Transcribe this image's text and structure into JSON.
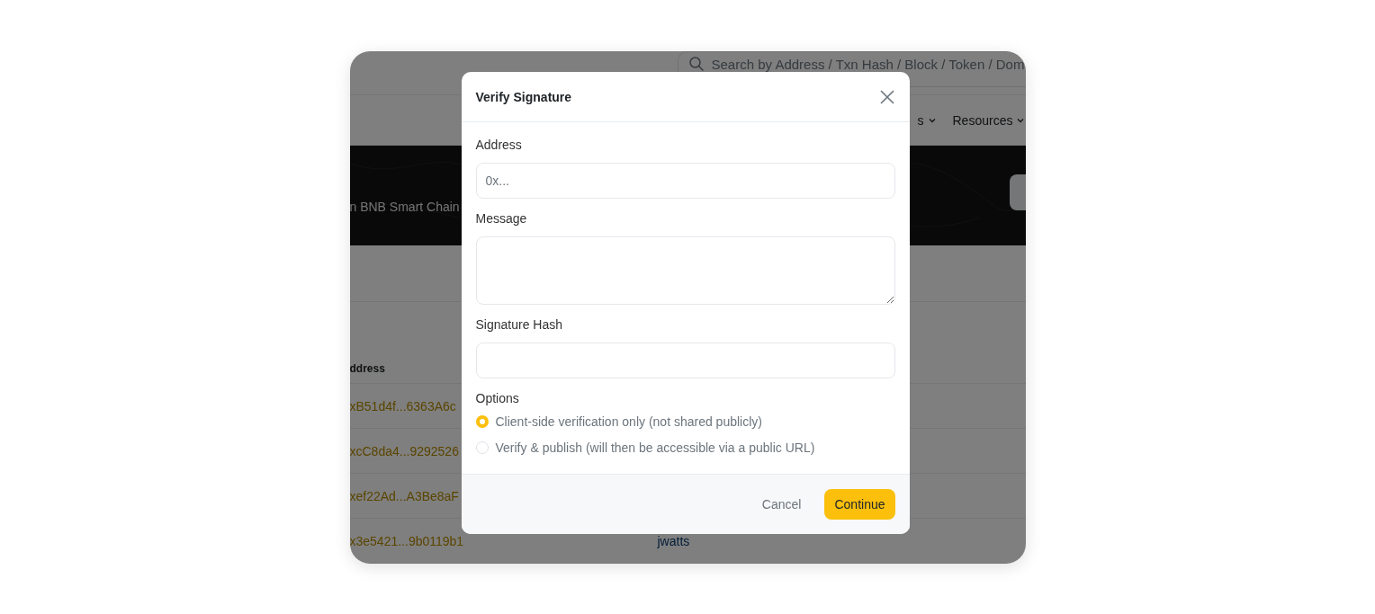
{
  "page": {
    "search": {
      "placeholder": "Search by Address / Txn Hash / Block / Token / Dom"
    },
    "nav": [
      {
        "label": "s"
      },
      {
        "label": "Resources"
      }
    ],
    "banner": {
      "text": "n BNB Smart Chain"
    },
    "table": {
      "columns": [
        "ddress"
      ],
      "rows": [
        {
          "address": "xB51d4f...6363A6c"
        },
        {
          "address": "xcC8da4...9292526"
        },
        {
          "address": "xef22Ad...A3Be8aF"
        },
        {
          "address": "x3e5421...9b0119b1",
          "column_2": "jwatts"
        }
      ]
    }
  },
  "modal": {
    "title": "Verify Signature",
    "fields": [
      {
        "kind": "input",
        "label": "Address",
        "placeholder": "0x..."
      },
      {
        "kind": "textarea",
        "label": "Message"
      },
      {
        "kind": "input",
        "label": "Signature Hash"
      }
    ],
    "options_label": "Options",
    "options": [
      {
        "label": "Client-side verification only (not shared publicly)",
        "selected": true
      },
      {
        "label": "Verify & publish (will then be accessible via a public URL)",
        "selected": false
      }
    ],
    "buttons": {
      "cancel": "Cancel",
      "continue": "Continue"
    }
  }
}
